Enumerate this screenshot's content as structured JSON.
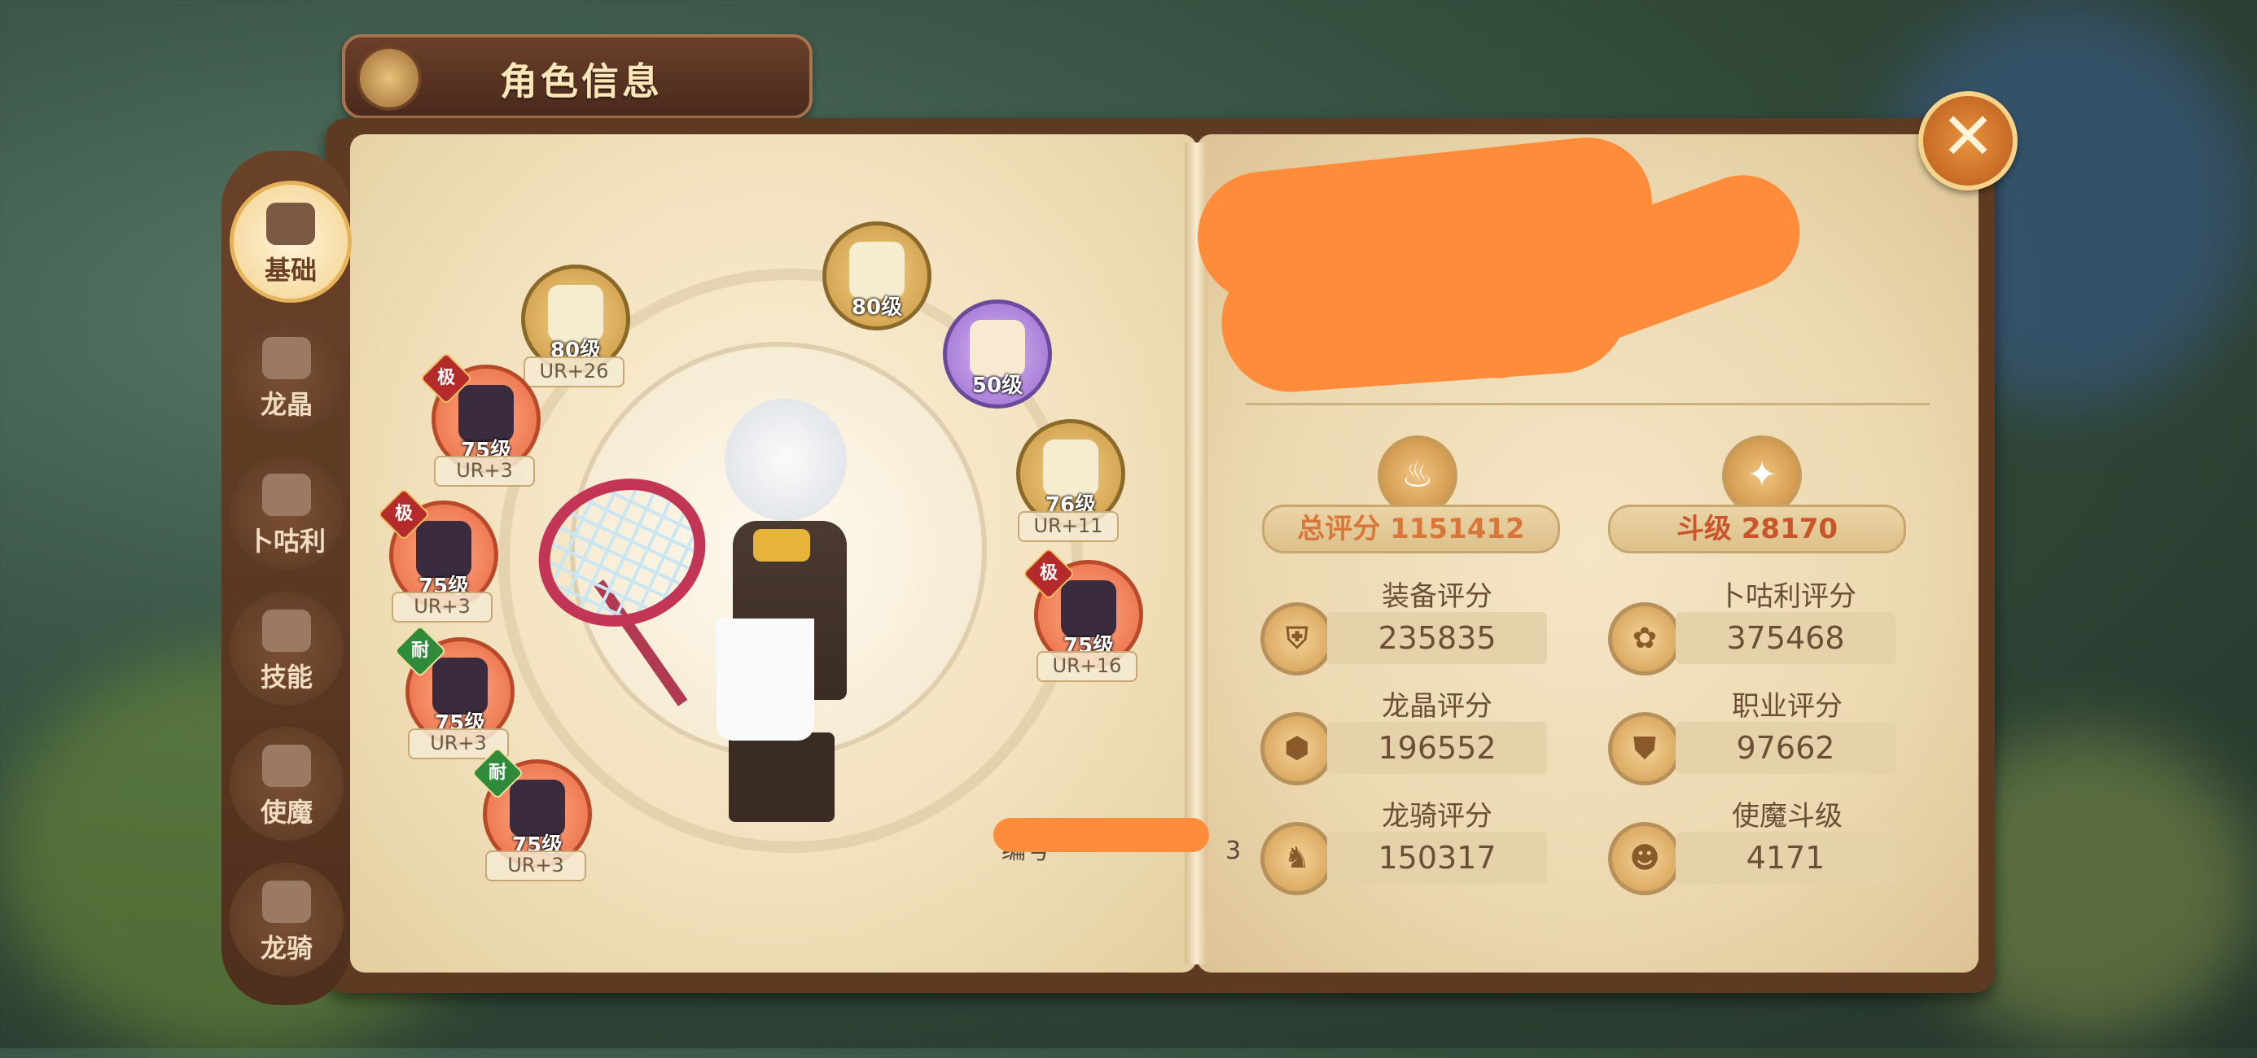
{
  "title": "角色信息",
  "side_tabs": [
    {
      "label": "基础",
      "active": true
    },
    {
      "label": "龙晶",
      "active": false
    },
    {
      "label": "卜咕利",
      "active": false
    },
    {
      "label": "技能",
      "active": false
    },
    {
      "label": "使魔",
      "active": false
    },
    {
      "label": "龙骑",
      "active": false
    }
  ],
  "equipment": {
    "weapon": {
      "level": "80级",
      "ur": "UR+26"
    },
    "helmet_top": {
      "level": "80级"
    },
    "trophy": {
      "level": "50级"
    },
    "ring": {
      "level": "76级",
      "ur": "UR+11"
    },
    "chest": {
      "level": "75级",
      "ur": "UR+3",
      "badge": "极"
    },
    "shoulder": {
      "level": "75级",
      "ur": "UR+3",
      "badge": "极"
    },
    "pants": {
      "level": "75级",
      "ur": "UR+3",
      "badge": "耐"
    },
    "boots": {
      "level": "75级",
      "ur": "UR+3",
      "badge": "耐"
    },
    "gloves": {
      "level": "75级",
      "ur": "UR+16",
      "badge": "极"
    }
  },
  "id_line": "编号",
  "id_suffix": "3",
  "stats": {
    "total_label": "总评分 1151412",
    "fight_level_label": "斗级 28170",
    "equip": {
      "label": "装备评分",
      "value": "235835"
    },
    "bugli": {
      "label": "卜咕利评分",
      "value": "375468"
    },
    "dragon_crystal": {
      "label": "龙晶评分",
      "value": "196552"
    },
    "job": {
      "label": "职业评分",
      "value": "97662"
    },
    "dragon_rider": {
      "label": "龙骑评分",
      "value": "150317"
    },
    "familiar": {
      "label": "使魔斗级",
      "value": "4171"
    }
  },
  "close_symbol": "✕",
  "colors": {
    "accent_orange": "#ff8c3a",
    "panel_brown": "#5e3a22",
    "paper": "#f2e1bd"
  }
}
